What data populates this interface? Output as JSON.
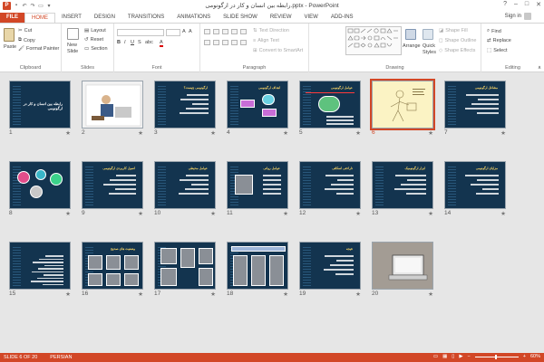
{
  "app": {
    "logo_letter": "P",
    "window_title": "رابطه بین انسان و کار در ارگونومی.pptx - PowerPoint",
    "accent_color": "#d24726",
    "signin": "Sign in",
    "controls": [
      "?",
      "–",
      "□",
      "✕"
    ]
  },
  "tabs": [
    "FILE",
    "HOME",
    "INSERT",
    "DESIGN",
    "TRANSITIONS",
    "ANIMATIONS",
    "SLIDE SHOW",
    "REVIEW",
    "VIEW",
    "ADD-INS"
  ],
  "active_tab": "HOME",
  "ribbon": {
    "clipboard": {
      "label": "Clipboard",
      "paste": "Paste",
      "cut": "Cut",
      "copy": "Copy",
      "format_painter": "Format Painter"
    },
    "slides": {
      "label": "Slides",
      "new_slide": "New",
      "new_slide_2": "Slide",
      "layout": "Layout",
      "reset": "Reset",
      "section": "Section"
    },
    "font": {
      "label": "Font"
    },
    "paragraph": {
      "label": "Paragraph",
      "text_direction": "Text Direction",
      "align_text": "Align Text",
      "smartart": "Convert to SmartArt"
    },
    "drawing": {
      "label": "Drawing",
      "arrange": "Arrange",
      "quick_styles": "Quick",
      "quick_styles_2": "Styles",
      "shape_fill": "Shape Fill",
      "shape_outline": "Shape Outline",
      "shape_effects": "Shape Effects"
    },
    "editing": {
      "label": "Editing",
      "find": "Find",
      "replace": "Replace",
      "select": "Select"
    }
  },
  "slides": [
    {
      "num": "1",
      "title": "رابطه بین انسان و کار در ارگونومی",
      "kind": "title"
    },
    {
      "num": "2",
      "title": "",
      "kind": "cartoon"
    },
    {
      "num": "3",
      "title": "ارگونومی چیست؟",
      "kind": "text"
    },
    {
      "num": "4",
      "title": "اهداف ارگونومی",
      "kind": "diagram"
    },
    {
      "num": "5",
      "title": "عوامل ارگونومی",
      "kind": "diagram2"
    },
    {
      "num": "6",
      "title": "",
      "kind": "sketch"
    },
    {
      "num": "7",
      "title": "مشاغل ارگونومی",
      "kind": "text"
    },
    {
      "num": "8",
      "title": "",
      "kind": "circles"
    },
    {
      "num": "9",
      "title": "اصول کاربردی ارگونومی",
      "kind": "text"
    },
    {
      "num": "10",
      "title": "عوامل محیطی",
      "kind": "text"
    },
    {
      "num": "11",
      "title": "عوامل روانی",
      "kind": "photo"
    },
    {
      "num": "12",
      "title": "ناراحتی اسکلتی",
      "kind": "text"
    },
    {
      "num": "13",
      "title": "ابزار ارگونومیک",
      "kind": "text"
    },
    {
      "num": "14",
      "title": "مزایای ارگونومی",
      "kind": "text"
    },
    {
      "num": "15",
      "title": "",
      "kind": "dense"
    },
    {
      "num": "16",
      "title": "وضعیت های صحیح",
      "kind": "photos"
    },
    {
      "num": "17",
      "title": "",
      "kind": "photos2"
    },
    {
      "num": "18",
      "title": "",
      "kind": "banner"
    },
    {
      "num": "19",
      "title": "نتیجه",
      "kind": "text"
    },
    {
      "num": "20",
      "title": "",
      "kind": "laptop"
    }
  ],
  "selected_slide": "6",
  "status": {
    "slide_info": "SLIDE 6 OF 20",
    "language": "PERSIAN",
    "zoom": "60%",
    "zoom_level": 0.6
  }
}
